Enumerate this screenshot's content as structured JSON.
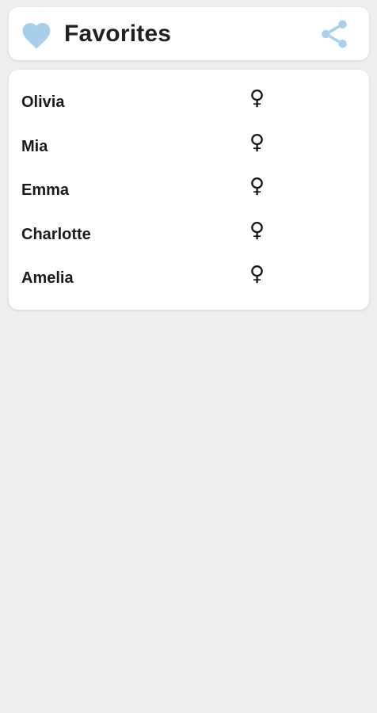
{
  "header": {
    "title": "Favorites",
    "icons": {
      "favorite": "heart-icon",
      "share": "share-icon"
    },
    "accent_color": "#a8cfec"
  },
  "favorites": [
    {
      "name": "Olivia",
      "gender_symbol": "♀"
    },
    {
      "name": "Mia",
      "gender_symbol": "♀"
    },
    {
      "name": "Emma",
      "gender_symbol": "♀"
    },
    {
      "name": "Charlotte",
      "gender_symbol": "♀"
    },
    {
      "name": "Amelia",
      "gender_symbol": "♀"
    }
  ]
}
